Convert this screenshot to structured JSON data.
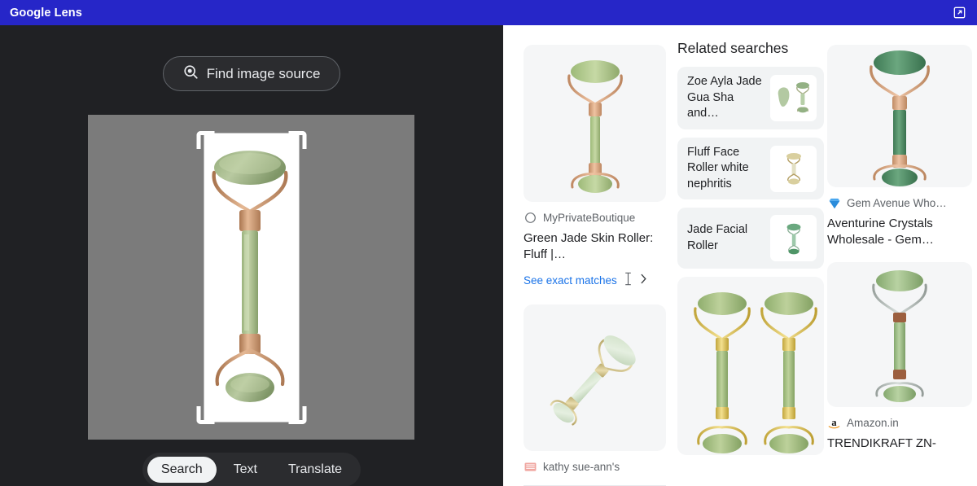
{
  "window": {
    "title": "Google Lens",
    "accent_color": "#2626c8",
    "open_external_icon": "open-in-new-icon"
  },
  "left_panel": {
    "background_color": "#202124",
    "find_image_source": {
      "label": "Find image source",
      "icon": "lens-search-icon"
    },
    "image": {
      "alt": "green jade face roller on white card, gray background",
      "background_color": "#7b7b7b",
      "selection": "crop-selection-corners"
    },
    "modes": [
      {
        "label": "Search",
        "active": true
      },
      {
        "label": "Text",
        "active": false
      },
      {
        "label": "Translate",
        "active": false
      }
    ]
  },
  "results": {
    "related": {
      "heading": "Related searches",
      "chips": [
        {
          "text": "Zoe Ayla Jade Gua Sha and…",
          "thumb": "gua-sha-and-roller-thumb"
        },
        {
          "text": "Fluff Face Roller white nephritis",
          "thumb": "white-nephritis-roller-thumb"
        },
        {
          "text": "Jade Facial Roller",
          "thumb": "jade-facial-roller-thumb"
        }
      ]
    },
    "cards": [
      {
        "id": "myprivateboutique",
        "source": "MyPrivateBoutique",
        "favicon": "circle-outline-icon",
        "favicon_color": "#70757a",
        "title": "Green Jade Skin Roller: Fluff |…",
        "exact_matches_label": "See exact matches",
        "exact_matches_color": "#1a73e8",
        "chevron_icon": "chevron-right-icon",
        "cursor_icon": "text-cursor-icon",
        "image_alt": "jade roller with rose gold handle"
      },
      {
        "id": "gemavenue",
        "source": "Gem Avenue Who…",
        "favicon": "gem-icon",
        "favicon_color": "#1a73e8",
        "title": "Aventurine Crystals Wholesale - Gem…",
        "image_alt": "dark green aventurine roller with rose gold frame"
      },
      {
        "id": "kathysueanns",
        "source": "kathy sue-ann's",
        "favicon": "pink-square-icon",
        "favicon_color": "#f0a6a0",
        "title": "",
        "image_alt": "pale jade roller at an angle"
      },
      {
        "id": "amazon",
        "source": "Amazon.in",
        "favicon": "amazon-a-icon",
        "favicon_color": "#000000",
        "title": "TRENDIKRAFT ZN-",
        "image_alt": "jade roller with copper bands"
      },
      {
        "id": "double-roller",
        "source": "",
        "favicon": "",
        "title": "",
        "image_alt": "two gold-framed jade rollers side by side"
      }
    ]
  }
}
